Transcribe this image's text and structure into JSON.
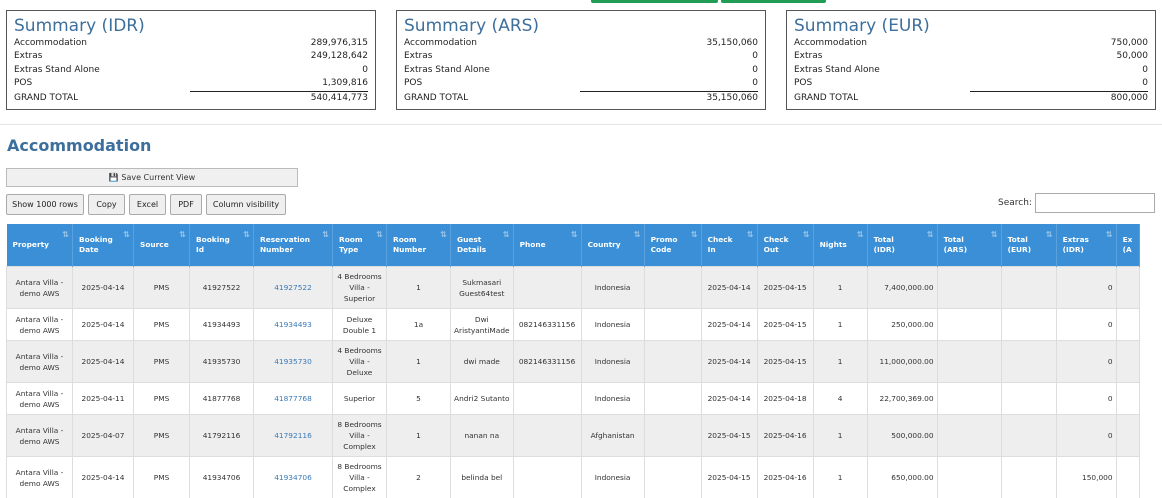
{
  "summaries": [
    {
      "title": "Summary (IDR)",
      "rows": [
        {
          "label": "Accommodation",
          "value": "289,976,315"
        },
        {
          "label": "Extras",
          "value": "249,128,642"
        },
        {
          "label": "Extras Stand Alone",
          "value": "0"
        },
        {
          "label": "POS",
          "value": "1,309,816"
        },
        {
          "label": "GRAND TOTAL",
          "value": "540,414,773"
        }
      ]
    },
    {
      "title": "Summary (ARS)",
      "rows": [
        {
          "label": "Accommodation",
          "value": "35,150,060"
        },
        {
          "label": "Extras",
          "value": "0"
        },
        {
          "label": "Extras Stand Alone",
          "value": "0"
        },
        {
          "label": "POS",
          "value": "0"
        },
        {
          "label": "GRAND TOTAL",
          "value": "35,150,060"
        }
      ]
    },
    {
      "title": "Summary (EUR)",
      "rows": [
        {
          "label": "Accommodation",
          "value": "750,000"
        },
        {
          "label": "Extras",
          "value": "50,000"
        },
        {
          "label": "Extras Stand Alone",
          "value": "0"
        },
        {
          "label": "POS",
          "value": "0"
        },
        {
          "label": "GRAND TOTAL",
          "value": "800,000"
        }
      ]
    }
  ],
  "section_title": "Accommodation",
  "save_view_label": "Save Current View",
  "toolbar": {
    "show_rows": "Show 1000 rows",
    "copy": "Copy",
    "excel": "Excel",
    "pdf": "PDF",
    "column_visibility": "Column visibility"
  },
  "search_label": "Search:",
  "columns": [
    [
      "Property",
      ""
    ],
    [
      "Booking",
      "Date"
    ],
    [
      "Source",
      ""
    ],
    [
      "Booking",
      "Id"
    ],
    [
      "Reservation",
      "Number"
    ],
    [
      "Room",
      "Type"
    ],
    [
      "Room",
      "Number"
    ],
    [
      "Guest",
      "Details"
    ],
    [
      "Phone",
      ""
    ],
    [
      "Country",
      ""
    ],
    [
      "Promo",
      "Code"
    ],
    [
      "Check",
      "In"
    ],
    [
      "Check",
      "Out"
    ],
    [
      "Nights",
      ""
    ],
    [
      "Total",
      "(IDR)"
    ],
    [
      "Total",
      "(ARS)"
    ],
    [
      "Total",
      "(EUR)"
    ],
    [
      "Extras",
      "(IDR)"
    ],
    [
      "Ex",
      "(A"
    ]
  ],
  "rows": [
    {
      "property": "Antara Villa - demo AWS",
      "booking_date": "2025-04-14",
      "source": "PMS",
      "booking_id": "41927522",
      "reservation": "41927522",
      "room_type": "4 Bedrooms Villa - Superior",
      "room_number": "1",
      "guest": "Sukmasari Guest64test",
      "phone": "",
      "country": "Indonesia",
      "promo": "",
      "check_in": "2025-04-14",
      "check_out": "2025-04-15",
      "nights": "1",
      "total_idr": "7,400,000.00",
      "total_ars": "",
      "total_eur": "",
      "extras_idr": "0",
      "extras_ars": ""
    },
    {
      "property": "Antara Villa - demo AWS",
      "booking_date": "2025-04-14",
      "source": "PMS",
      "booking_id": "41934493",
      "reservation": "41934493",
      "room_type": "Deluxe Double 1",
      "room_number": "1a",
      "guest": "Dwi AristyantiMade",
      "phone": "082146331156",
      "country": "Indonesia",
      "promo": "",
      "check_in": "2025-04-14",
      "check_out": "2025-04-15",
      "nights": "1",
      "total_idr": "250,000.00",
      "total_ars": "",
      "total_eur": "",
      "extras_idr": "0",
      "extras_ars": ""
    },
    {
      "property": "Antara Villa - demo AWS",
      "booking_date": "2025-04-14",
      "source": "PMS",
      "booking_id": "41935730",
      "reservation": "41935730",
      "room_type": "4 Bedrooms Villa - Deluxe",
      "room_number": "1",
      "guest": "dwi made",
      "phone": "082146331156",
      "country": "Indonesia",
      "promo": "",
      "check_in": "2025-04-14",
      "check_out": "2025-04-15",
      "nights": "1",
      "total_idr": "11,000,000.00",
      "total_ars": "",
      "total_eur": "",
      "extras_idr": "0",
      "extras_ars": ""
    },
    {
      "property": "Antara Villa - demo AWS",
      "booking_date": "2025-04-11",
      "source": "PMS",
      "booking_id": "41877768",
      "reservation": "41877768",
      "room_type": "Superior",
      "room_number": "5",
      "guest": "Andri2 Sutanto",
      "phone": "",
      "country": "Indonesia",
      "promo": "",
      "check_in": "2025-04-14",
      "check_out": "2025-04-18",
      "nights": "4",
      "total_idr": "22,700,369.00",
      "total_ars": "",
      "total_eur": "",
      "extras_idr": "0",
      "extras_ars": ""
    },
    {
      "property": "Antara Villa - demo AWS",
      "booking_date": "2025-04-07",
      "source": "PMS",
      "booking_id": "41792116",
      "reservation": "41792116",
      "room_type": "8 Bedrooms Villa - Complex",
      "room_number": "1",
      "guest": "nanan na",
      "phone": "",
      "country": "Afghanistan",
      "promo": "",
      "check_in": "2025-04-15",
      "check_out": "2025-04-16",
      "nights": "1",
      "total_idr": "500,000.00",
      "total_ars": "",
      "total_eur": "",
      "extras_idr": "0",
      "extras_ars": ""
    },
    {
      "property": "Antara Villa - demo AWS",
      "booking_date": "2025-04-14",
      "source": "PMS",
      "booking_id": "41934706",
      "reservation": "41934706",
      "room_type": "8 Bedrooms Villa - Complex",
      "room_number": "2",
      "guest": "belinda bel",
      "phone": "",
      "country": "Indonesia",
      "promo": "",
      "check_in": "2025-04-15",
      "check_out": "2025-04-16",
      "nights": "1",
      "total_idr": "650,000.00",
      "total_ars": "",
      "total_eur": "",
      "extras_idr": "150,000",
      "extras_ars": ""
    }
  ]
}
